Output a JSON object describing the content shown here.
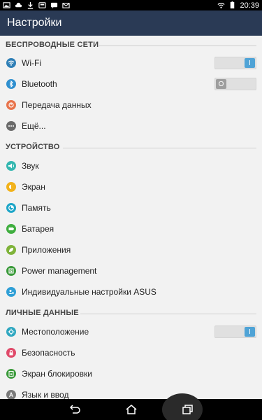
{
  "status_bar": {
    "time": "20:39",
    "left_icons": [
      "photo-icon",
      "cloud-icon",
      "download-icon",
      "card-icon",
      "sms-icon",
      "email-icon"
    ],
    "right_icons": [
      "wifi-icon",
      "battery-icon"
    ]
  },
  "app_bar": {
    "title": "Настройки"
  },
  "sections": {
    "wireless": "БЕСПРОВОДНЫЕ СЕТИ",
    "device": "УСТРОЙСТВО",
    "personal": "ЛИЧНЫЕ ДАННЫЕ"
  },
  "items": {
    "wifi": {
      "label": "Wi-Fi",
      "icon": "wifi-icon",
      "toggle": "I",
      "color": "#2f7fb6"
    },
    "bluetooth": {
      "label": "Bluetooth",
      "icon": "bluetooth-icon",
      "toggle": "O",
      "color": "#2f8fcf"
    },
    "data": {
      "label": "Передача данных",
      "icon": "data-usage-icon",
      "color": "#e8744c"
    },
    "more": {
      "label": "Ещё...",
      "icon": "more-icon",
      "color": "#6b6b6b"
    },
    "sound": {
      "label": "Звук",
      "icon": "speaker-icon",
      "color": "#35b7b0"
    },
    "display": {
      "label": "Экран",
      "icon": "brightness-icon",
      "color": "#f2b21a"
    },
    "storage": {
      "label": "Память",
      "icon": "storage-icon",
      "color": "#1ea6c8"
    },
    "battery": {
      "label": "Батарея",
      "icon": "battery-icon",
      "color": "#3fae3f"
    },
    "apps": {
      "label": "Приложения",
      "icon": "apps-icon",
      "color": "#7fb33a"
    },
    "power": {
      "label": "Power management",
      "icon": "power-management-icon",
      "color": "#3a9a3a"
    },
    "asus": {
      "label": "Индивидуальные настройки ASUS",
      "icon": "asus-settings-icon",
      "color": "#2f9fd6"
    },
    "location": {
      "label": "Местоположение",
      "icon": "location-icon",
      "toggle": "I",
      "color": "#2fa7c0"
    },
    "security": {
      "label": "Безопасность",
      "icon": "lock-icon",
      "color": "#e04a6a"
    },
    "lockscreen": {
      "label": "Экран блокировки",
      "icon": "lockscreen-icon",
      "color": "#3a9a3a"
    },
    "language": {
      "label": "Язык и ввод",
      "icon": "language-icon",
      "color": "#7a7a7a"
    }
  },
  "nav_bar": [
    "back-icon",
    "home-icon",
    "recents-icon"
  ],
  "colors": {
    "accent": "#4fa3d6",
    "app_bar": "#2a3a55",
    "background": "#f2f2f2"
  }
}
